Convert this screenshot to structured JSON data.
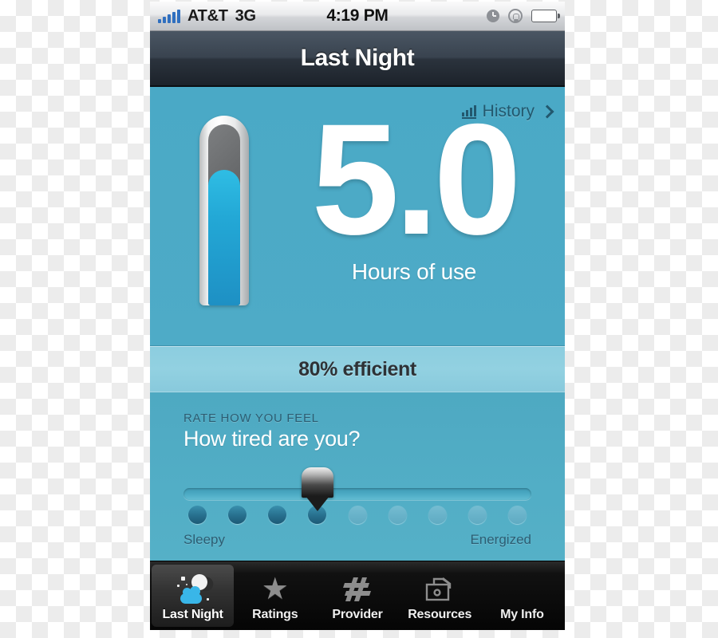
{
  "statusbar": {
    "carrier": "AT&T",
    "network": "3G",
    "time": "4:19 PM",
    "signal_bars": 5,
    "battery_percent": 78,
    "icons": [
      "signal-bars-icon",
      "clock-icon",
      "rotation-lock-icon",
      "battery-icon"
    ]
  },
  "navbar": {
    "title": "Last Night"
  },
  "content": {
    "history_link": "History",
    "gauge": {
      "fill_percent": 75,
      "name": "hours-of-use-gauge"
    },
    "reading": {
      "value": "5.0",
      "label": "Hours of use"
    },
    "efficiency": {
      "text": "80% efficient"
    },
    "rating": {
      "eyebrow": "RATE HOW YOU FEEL",
      "question": "How tired are you?",
      "left_label": "Sleepy",
      "right_label": "Energized",
      "steps": 9,
      "selected_index": 4,
      "dot_states": [
        "on",
        "on",
        "on",
        "on",
        "off",
        "off",
        "off",
        "off",
        "off"
      ]
    }
  },
  "tabbar": {
    "items": [
      {
        "label": "Last Night",
        "icon": "moon-cloud-icon",
        "active": true
      },
      {
        "label": "Ratings",
        "icon": "star-icon",
        "active": false
      },
      {
        "label": "Provider",
        "icon": "hash-slash-icon",
        "active": false
      },
      {
        "label": "Resources",
        "icon": "folder-icon",
        "active": false
      },
      {
        "label": "My Info",
        "icon": "person-icon",
        "active": false
      }
    ]
  },
  "colors": {
    "screen_teal": "#4aa9c6",
    "band_teal": "#90d0e0",
    "navbar_dark": "#39434f",
    "gauge_blue": "#23a8d6",
    "accent_cloud": "#39b6e8"
  }
}
